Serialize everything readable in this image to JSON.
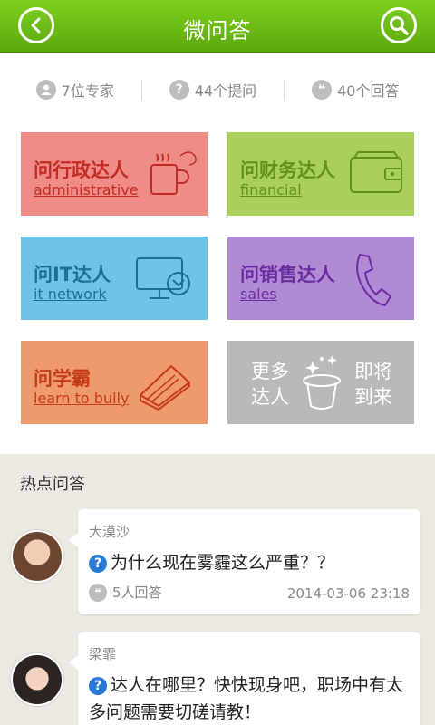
{
  "header": {
    "title": "微问答",
    "back_icon": "back-arrow-icon",
    "search_icon": "search-icon",
    "brand_color": "#6cbe14"
  },
  "stats": [
    {
      "icon": "person-icon",
      "label": "7位专家"
    },
    {
      "icon": "question-icon",
      "label": "44个提问"
    },
    {
      "icon": "quote-icon",
      "label": "40个回答"
    }
  ],
  "categories": [
    {
      "id": "admin",
      "cn": "问行政达人",
      "en": "administrative",
      "icon": "coffee-mug-icon",
      "color": "#f08c86"
    },
    {
      "id": "fin",
      "cn": "问财务达人",
      "en": "financial",
      "icon": "wallet-icon",
      "color": "#a9d05a"
    },
    {
      "id": "it",
      "cn": "问IT达人",
      "en": "it network",
      "icon": "monitor-icon",
      "color": "#6ec3e6"
    },
    {
      "id": "sales",
      "cn": "问销售达人",
      "en": "sales",
      "icon": "phone-icon",
      "color": "#b18ad6"
    },
    {
      "id": "bully",
      "cn": "问学霸",
      "en": "learn to bully",
      "icon": "book-icon",
      "color": "#ef9a6e"
    },
    {
      "id": "more",
      "left_top": "更多",
      "left_bottom": "达人",
      "right_top": "即将",
      "right_bottom": "到来",
      "icon": "magic-hat-icon",
      "color": "#b9b9b9"
    }
  ],
  "hot": {
    "title": "热点问答",
    "items": [
      {
        "author": "大漠沙",
        "question": "为什么现在雾霾这么严重？？",
        "answers": "5人回答",
        "date": "2014-03-06  23:18"
      },
      {
        "author": "梁霏",
        "question": "达人在哪里？快快现身吧，职场中有太多问题需要切磋请教！"
      }
    ]
  }
}
